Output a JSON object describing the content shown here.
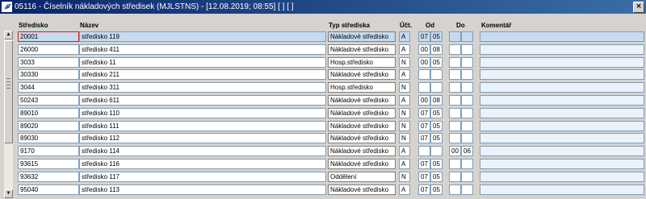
{
  "window": {
    "title": "05116 - Číselník nákladových středisek (MJLSTNS) - [12.08.2019; 08:55]  [ ]  [ ]",
    "app_icon": "app-icon",
    "close_icon": "close-icon"
  },
  "columns": {
    "stredisko": "Středisko",
    "nazev": "Název",
    "typ": "Typ střediska",
    "uct": "Účt.",
    "od": "Od",
    "do": "Do",
    "komentar": "Komentář"
  },
  "scrollbar": {
    "up_icon": "scroll-up-icon",
    "down_icon": "scroll-down-icon",
    "grip_icon": "grip-icon"
  },
  "rows": [
    {
      "code": "20001",
      "name": "středisko 119",
      "typ": "Nákladové středisko",
      "uct": "A",
      "od1": "07",
      "od2": "05",
      "do1": "",
      "do2": "",
      "komentar": ""
    },
    {
      "code": "26000",
      "name": "středisko 411",
      "typ": "Nákladové středisko",
      "uct": "A",
      "od1": "00",
      "od2": "08",
      "do1": "",
      "do2": "",
      "komentar": ""
    },
    {
      "code": "3033",
      "name": "středisko 11",
      "typ": "Hosp.středisko",
      "uct": "N",
      "od1": "00",
      "od2": "05",
      "do1": "",
      "do2": "",
      "komentar": ""
    },
    {
      "code": "30330",
      "name": "středisko 211",
      "typ": "Nákladové středisko",
      "uct": "A",
      "od1": "",
      "od2": "",
      "do1": "",
      "do2": "",
      "komentar": ""
    },
    {
      "code": "3044",
      "name": "středisko 311",
      "typ": "Hosp.středisko",
      "uct": "N",
      "od1": "",
      "od2": "",
      "do1": "",
      "do2": "",
      "komentar": ""
    },
    {
      "code": "50243",
      "name": "středisko 611",
      "typ": "Nákladové středisko",
      "uct": "A",
      "od1": "00",
      "od2": "08",
      "do1": "",
      "do2": "",
      "komentar": ""
    },
    {
      "code": "89010",
      "name": "středisko 110",
      "typ": "Nákladové středisko",
      "uct": "N",
      "od1": "07",
      "od2": "05",
      "do1": "",
      "do2": "",
      "komentar": ""
    },
    {
      "code": "89020",
      "name": "středisko 111",
      "typ": "Nákladové středisko",
      "uct": "N",
      "od1": "07",
      "od2": "05",
      "do1": "",
      "do2": "",
      "komentar": ""
    },
    {
      "code": "89030",
      "name": "středisko 112",
      "typ": "Nákladové středisko",
      "uct": "N",
      "od1": "07",
      "od2": "05",
      "do1": "",
      "do2": "",
      "komentar": ""
    },
    {
      "code": "9170",
      "name": "středisko 114",
      "typ": "Nákladové středisko",
      "uct": "A",
      "od1": "",
      "od2": "",
      "do1": "00",
      "do2": "06",
      "komentar": ""
    },
    {
      "code": "93615",
      "name": "středisko 116",
      "typ": "Nákladové středisko",
      "uct": "A",
      "od1": "07",
      "od2": "05",
      "do1": "",
      "do2": "",
      "komentar": ""
    },
    {
      "code": "93632",
      "name": "středisko 117",
      "typ": "Oddělení",
      "uct": "N",
      "od1": "07",
      "od2": "05",
      "do1": "",
      "do2": "",
      "komentar": ""
    },
    {
      "code": "95040",
      "name": "středisko 113",
      "typ": "Nákladové středisko",
      "uct": "A",
      "od1": "07",
      "od2": "05",
      "do1": "",
      "do2": "",
      "komentar": ""
    }
  ]
}
